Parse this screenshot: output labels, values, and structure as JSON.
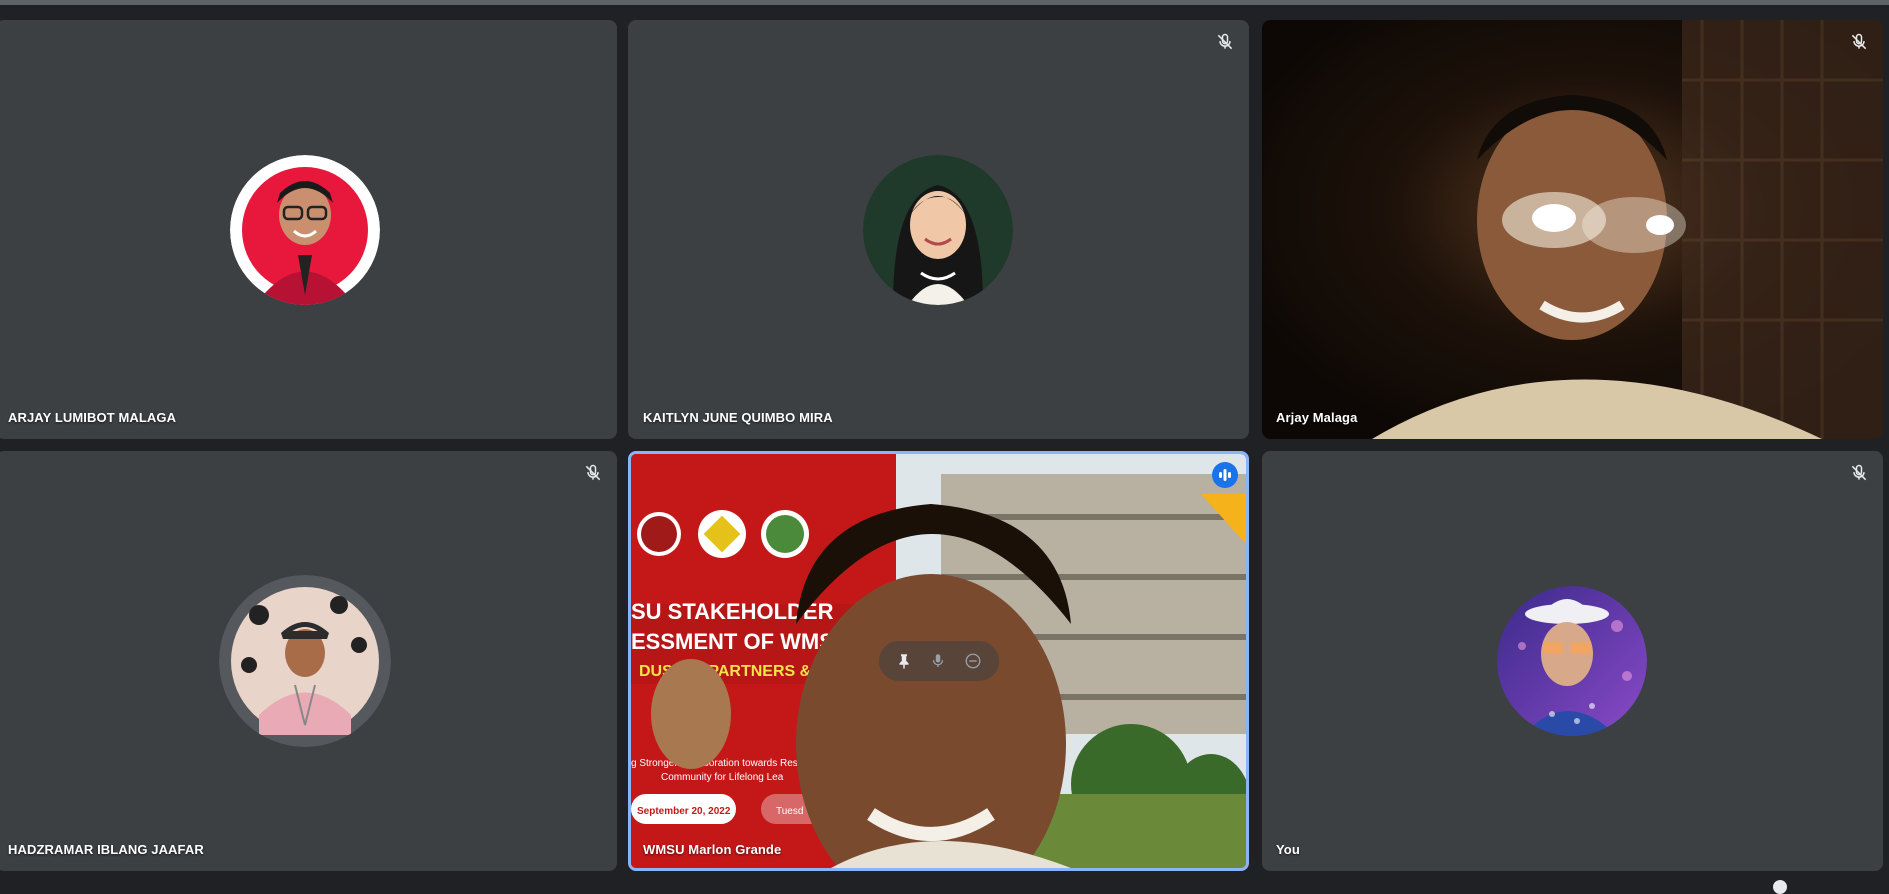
{
  "participants": [
    {
      "name": "ARJAY LUMIBOT MALAGA",
      "muted": false,
      "view": "avatar"
    },
    {
      "name": "KAITLYN JUNE QUIMBO MIRA",
      "muted": true,
      "view": "avatar"
    },
    {
      "name": "Arjay Malaga",
      "muted": true,
      "view": "video"
    },
    {
      "name": "HADZRAMAR IBLANG JAAFAR",
      "muted": true,
      "view": "avatar"
    },
    {
      "name": "WMSU Marlon Grande",
      "muted": false,
      "view": "video",
      "speaking": true
    },
    {
      "name": "You",
      "muted": true,
      "view": "avatar"
    }
  ],
  "background_slide": {
    "title_line1": "SU STAKEHOLDER",
    "title_line2": "ESSMENT OF WMS",
    "title_line3": "DUSTRY PARTNERS &",
    "subtitle_line1": "g Stronger Collaboration towards Resil",
    "subtitle_line2": "Community for Lifelong Lea",
    "date": "September 20, 2022",
    "day": "Tuesd"
  },
  "colors": {
    "background": "#202124",
    "tile": "#3c4043",
    "speaking_border": "#8ab4f8",
    "speaking_badge": "#1a73e8"
  },
  "icons": {
    "muted": "mic-off-icon",
    "speaking": "audio-level-icon",
    "pin": "pin-icon",
    "mic": "mic-icon",
    "remove": "remove-icon"
  }
}
